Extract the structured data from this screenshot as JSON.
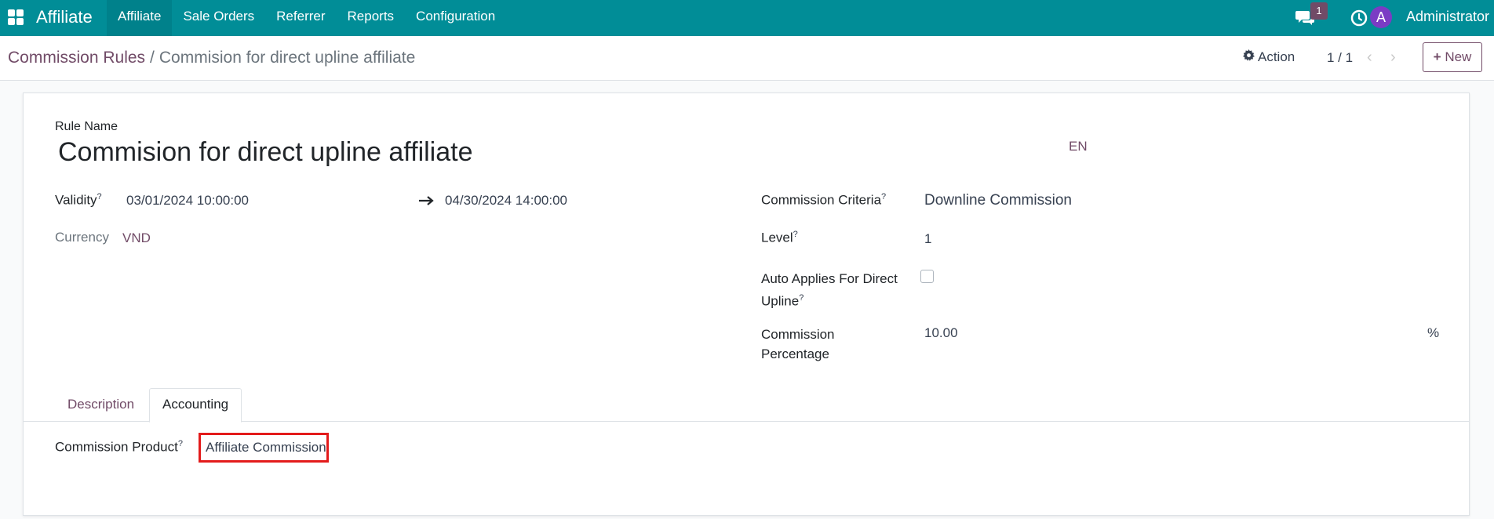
{
  "navbar": {
    "brand": "Affiliate",
    "menu": [
      "Affiliate",
      "Sale Orders",
      "Referrer",
      "Reports",
      "Configuration"
    ],
    "active_menu": "Affiliate",
    "chat_badge": "1",
    "user_initial": "A",
    "user_name": "Administrator"
  },
  "control": {
    "breadcrumb_parent": "Commission Rules",
    "breadcrumb_sep": "/",
    "breadcrumb_current": "Commision for direct upline affiliate",
    "action_label": "Action",
    "pager": "1 / 1",
    "new_label": "New"
  },
  "form": {
    "rule_name_label": "Rule Name",
    "rule_name": "Commision for direct upline affiliate",
    "lang": "EN",
    "validity_label": "Validity",
    "validity_start": "03/01/2024 10:00:00",
    "validity_end": "04/30/2024 14:00:00",
    "currency_label": "Currency",
    "currency": "VND",
    "criteria_label": "Commission Criteria",
    "criteria": "Downline Commission",
    "level_label": "Level",
    "level": "1",
    "auto_applies_label_1": "Auto Applies For Direct",
    "auto_applies_label_2": "Upline",
    "auto_applies_checked": false,
    "percentage_label_1": "Commission",
    "percentage_label_2": "Percentage",
    "percentage": "10.00",
    "percentage_unit": "%",
    "help_mark": "?"
  },
  "tabs": {
    "description": "Description",
    "accounting": "Accounting",
    "active": "Accounting"
  },
  "accounting": {
    "product_label": "Commission Product",
    "product": "Affiliate Commission"
  }
}
